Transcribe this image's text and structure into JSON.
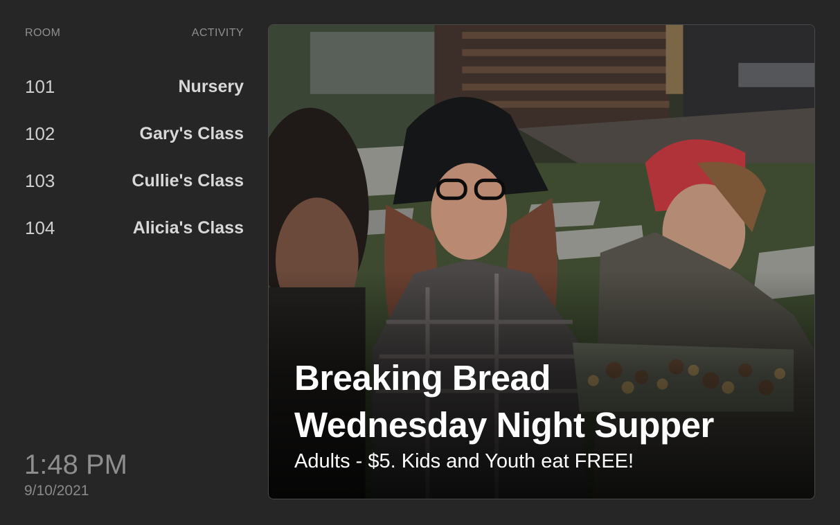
{
  "directory": {
    "header": {
      "room": "ROOM",
      "activity": "ACTIVITY"
    },
    "rows": [
      {
        "room": "101",
        "activity": "Nursery"
      },
      {
        "room": "102",
        "activity": "Gary's Class"
      },
      {
        "room": "103",
        "activity": "Cullie's Class"
      },
      {
        "room": "104",
        "activity": "Alicia's Class"
      }
    ]
  },
  "clock": {
    "time": "1:48 PM",
    "date": "9/10/2021"
  },
  "promo": {
    "title_line1": "Breaking Bread",
    "title_line2": "Wednesday Night Supper",
    "subtitle": "Adults - $5. Kids and Youth eat FREE!"
  }
}
